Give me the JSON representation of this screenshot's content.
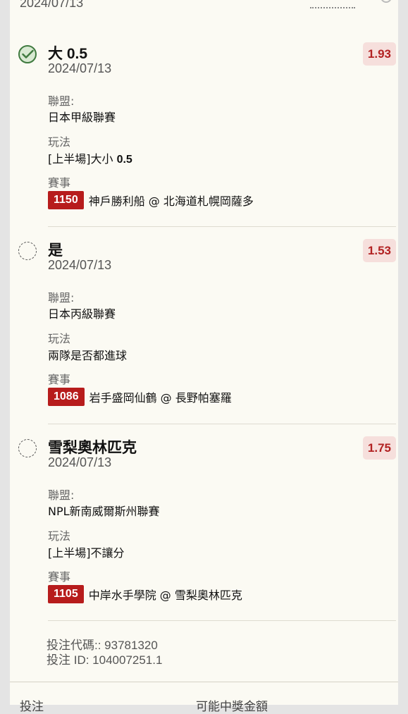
{
  "top_partial_date": "2024/07/13",
  "bets": [
    {
      "status": "checked",
      "selection": "大 0.5",
      "date": "2024/07/13",
      "odds": "1.93",
      "league_label": "聯盟:",
      "league": "日本甲級聯賽",
      "market_label": "玩法",
      "market": "[上半場]大小 0.5",
      "event_label": "賽事",
      "match_id": "1150",
      "match_name": "神戶勝利船 @ 北海道札幌岡薩多"
    },
    {
      "status": "unchecked",
      "selection": "是",
      "date": "2024/07/13",
      "odds": "1.53",
      "league_label": "聯盟:",
      "league": "日本丙級聯賽",
      "market_label": "玩法",
      "market": "兩隊是否都進球",
      "event_label": "賽事",
      "match_id": "1086",
      "match_name": "岩手盛岡仙鶴 @ 長野帕塞羅"
    },
    {
      "status": "unchecked",
      "selection": "雪梨奧林匹克",
      "date": "2024/07/13",
      "odds": "1.75",
      "league_label": "聯盟:",
      "league": "NPL新南威爾斯州聯賽",
      "market_label": "玩法",
      "market": "[上半場]不讓分",
      "event_label": "賽事",
      "match_id": "1105",
      "match_name": "中岸水手學院 @ 雪梨奧林匹克"
    }
  ],
  "footer": {
    "bet_code": "投注代碼:: 93781320",
    "bet_id": "投注 ID: 104007251.1"
  },
  "bottom": {
    "left_label": "投注",
    "right_label": "可能中獎金額"
  },
  "colors": {
    "accent_red": "#b71c1c",
    "odds_bg": "#f6dfdc",
    "check_green": "#3f7a3f"
  }
}
